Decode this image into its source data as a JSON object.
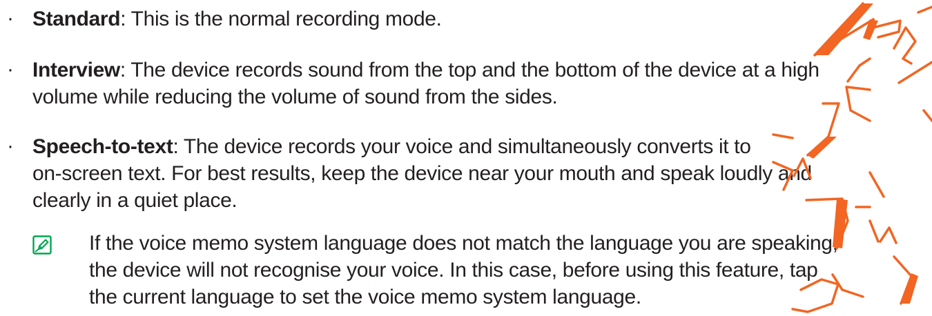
{
  "bullets": [
    {
      "term": "Standard",
      "lines": [
        ": This is the normal recording mode."
      ]
    },
    {
      "term": "Interview",
      "lines": [
        ": The device records sound from the top and the bottom of the device at a high",
        "volume while reducing the volume of sound from the sides."
      ]
    },
    {
      "term": "Speech-to-text",
      "lines": [
        ": The device records your voice and simultaneously converts it to",
        "on-screen text. For best results, keep the device near your mouth and speak loudly and",
        "clearly in a quiet place."
      ]
    }
  ],
  "note": {
    "icon": "note-pencil-icon",
    "lines": [
      "If the voice memo system language does not match the language you are speaking,",
      "the device will not recognise your voice. In this case, before using this feature, tap",
      "the current language to set the voice memo system language."
    ]
  },
  "colors": {
    "text": "#231f20",
    "note_icon": "#00a651",
    "watermark": "#f26522"
  },
  "watermark": {
    "kind": "handwritten-characters-overlay"
  }
}
